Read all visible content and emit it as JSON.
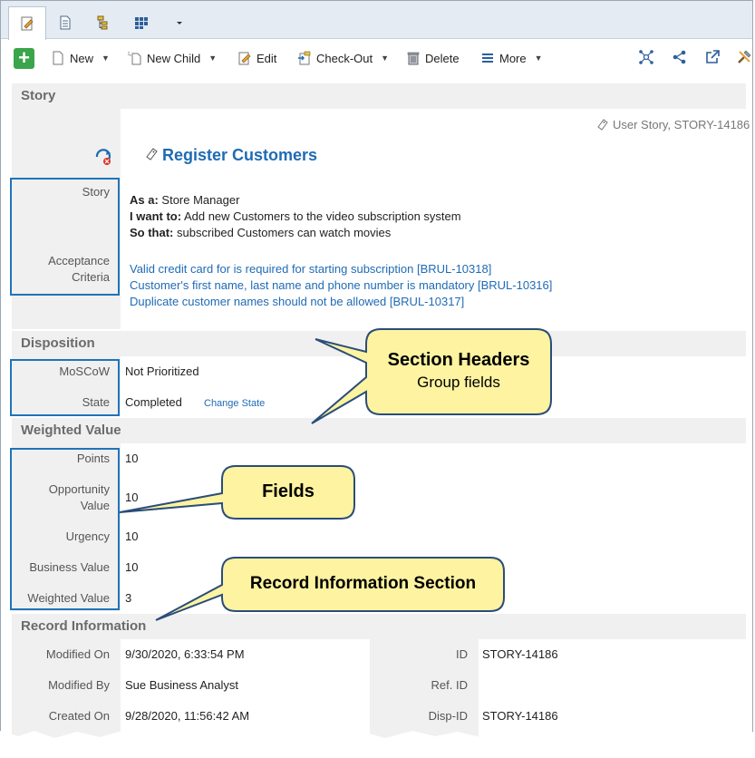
{
  "tabs": [
    {
      "icon": "edit-record-icon",
      "active": true
    },
    {
      "icon": "document-icon",
      "active": false
    },
    {
      "icon": "hierarchy-icon",
      "active": false
    },
    {
      "icon": "grid-icon",
      "active": false
    },
    {
      "icon": "chevron-down-icon",
      "active": false
    }
  ],
  "toolbar": {
    "new_label": "New",
    "new_child_label": "New Child",
    "edit_label": "Edit",
    "checkout_label": "Check-Out",
    "delete_label": "Delete",
    "more_label": "More"
  },
  "record": {
    "type_id": "User Story, STORY-14186",
    "title": "Register Customers"
  },
  "sections": {
    "story": "Story",
    "disposition": "Disposition",
    "weighted_value": "Weighted Value",
    "record_info": "Record Information"
  },
  "story": {
    "story_label": "Story",
    "as_a_label": "As a:",
    "as_a_value": "Store Manager",
    "want_label": "I want to:",
    "want_value": "Add new Customers to the video subscription system",
    "so_label": "So that:",
    "so_value": "subscribed Customers can watch movies",
    "acceptance_label_1": "Acceptance",
    "acceptance_label_2": "Criteria",
    "criteria": [
      "Valid credit card for is required for starting subscription [BRUL-10318]",
      "Customer's first name, last name and phone number is mandatory [BRUL-10316]",
      "Duplicate customer names should not be allowed [BRUL-10317]"
    ]
  },
  "disposition": {
    "moscow_label": "MoSCoW",
    "moscow_value": "Not Prioritized",
    "state_label": "State",
    "state_value": "Completed",
    "change_state": "Change State"
  },
  "weighted": {
    "points_label": "Points",
    "points_value": "10",
    "opportunity_label_1": "Opportunity",
    "opportunity_label_2": "Value",
    "opportunity_value": "10",
    "urgency_label": "Urgency",
    "urgency_value": "10",
    "business_label": "Business Value",
    "business_value": "10",
    "weighted_label": "Weighted Value",
    "weighted_value": "3"
  },
  "record_info": {
    "modified_on_label": "Modified On",
    "modified_on_value": "9/30/2020, 6:33:54 PM",
    "modified_by_label": "Modified By",
    "modified_by_value": "Sue Business Analyst",
    "created_on_label": "Created On",
    "created_on_value": "9/28/2020, 11:56:42 AM",
    "id_label": "ID",
    "id_value": "STORY-14186",
    "ref_id_label": "Ref. ID",
    "ref_id_value": "",
    "disp_id_label": "Disp-ID",
    "disp_id_value": "STORY-14186"
  },
  "callouts": {
    "section_headers_title": "Section Headers",
    "section_headers_sub": "Group fields",
    "fields": "Fields",
    "record_info_section": "Record Information Section"
  },
  "colors": {
    "accent_blue": "#1f6bb5",
    "box_blue": "#1f74b9",
    "callout_fill": "#fdf3a0",
    "callout_border": "#2a4d7a",
    "section_bg": "#f0f0f0",
    "add_green": "#3aa54a"
  }
}
